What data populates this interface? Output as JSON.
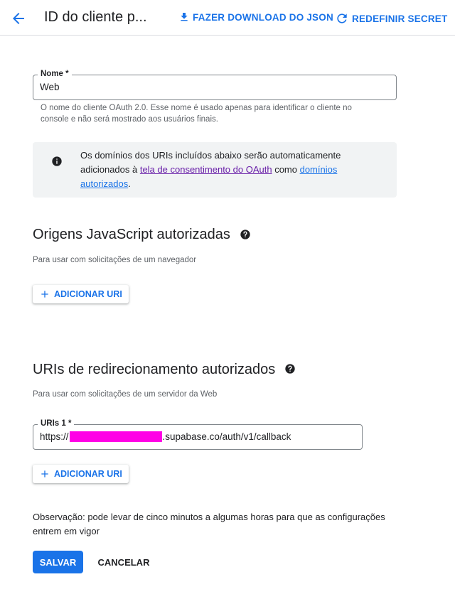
{
  "header": {
    "title": "ID do cliente p...",
    "download_label": "FAZER DOWNLOAD DO JSON",
    "reset_label": "REDEFINIR SECRET"
  },
  "name_field": {
    "label": "Nome *",
    "value": "Web",
    "helper": "O nome do cliente OAuth 2.0. Esse nome é usado apenas para identificar o cliente no console e não será mostrado aos usuários finais."
  },
  "info_box": {
    "text_before": "Os domínios dos URIs incluídos abaixo serão automaticamente adicionados à ",
    "consent_link": "tela de consentimento do OAuth",
    "text_middle": " como ",
    "domains_link": "domínios autorizados",
    "text_after": "."
  },
  "js_origins": {
    "title": "Origens JavaScript autorizadas",
    "subtitle": "Para usar com solicitações de um navegador",
    "add_label": "ADICIONAR URI"
  },
  "redirect_uris": {
    "title": "URIs de redirecionamento autorizados",
    "subtitle": "Para usar com solicitações de um servidor da Web",
    "field_label": "URIs 1 *",
    "value_prefix": "https://",
    "value_suffix": ".supabase.co/auth/v1/callback",
    "add_label": "ADICIONAR URI"
  },
  "note": "Observação: pode levar de cinco minutos a algumas horas para que as configurações entrem em vigor",
  "actions": {
    "save_label": "SALVAR",
    "cancel_label": "CANCELAR"
  },
  "colors": {
    "primary": "#1a73e8",
    "visited_link": "#681da8",
    "redaction": "#ff00e6",
    "info_background": "#f1f3f4"
  },
  "icons": [
    "arrow-back-icon",
    "download-icon",
    "refresh-icon",
    "info-icon",
    "help-icon",
    "plus-icon"
  ]
}
